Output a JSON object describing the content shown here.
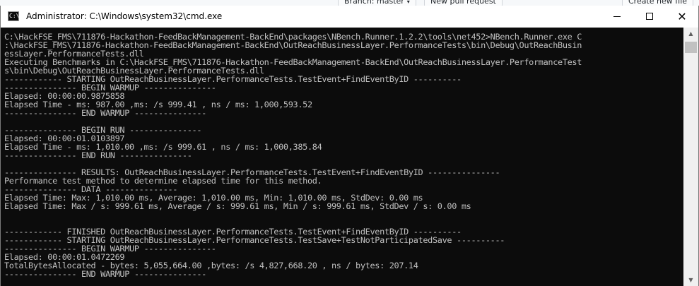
{
  "background": {
    "branch_label": "Branch: master",
    "new_pull_request_label": "New pull request",
    "create_new_file_label": "Create new file"
  },
  "window": {
    "title": "Administrator: C:\\Windows\\system32\\cmd.exe",
    "icon": "cmd-app-icon",
    "icon_glyph": "C:\\",
    "controls": {
      "minimize": "minimize-icon",
      "maximize": "maximize-icon",
      "close": "close-icon",
      "close_glyph": "✕"
    }
  },
  "console": {
    "background_color": "#0c0c0c",
    "text_color": "#c0c0c0",
    "lines": [
      "C:\\HackFSE_FMS\\711876-Hackathon-FeedBackManagement-BackEnd\\packages\\NBench.Runner.1.2.2\\tools\\net452>NBench.Runner.exe C",
      ":\\HackFSE_FMS\\711876-Hackathon-FeedBackManagement-BackEnd\\OutReachBusinessLayer.PerformanceTests\\bin\\Debug\\OutReachBusin",
      "essLayer.PerformanceTests.dll",
      "Executing Benchmarks in C:\\HackFSE_FMS\\711876-Hackathon-FeedBackManagement-BackEnd\\OutReachBusinessLayer.PerformanceTest",
      "s\\bin\\Debug\\OutReachBusinessLayer.PerformanceTests.dll",
      "------------ STARTING OutReachBusinessLayer.PerformanceTests.TestEvent+FindEventByID ----------",
      "--------------- BEGIN WARMUP ---------------",
      "Elapsed: 00:00:00.9875858",
      "Elapsed Time - ms: 987.00 ,ms: /s 999.41 , ns / ms: 1,000,593.52",
      "--------------- END WARMUP ---------------",
      "",
      "--------------- BEGIN RUN ---------------",
      "Elapsed: 00:00:01.0103897",
      "Elapsed Time - ms: 1,010.00 ,ms: /s 999.61 , ns / ms: 1,000,385.84",
      "--------------- END RUN ---------------",
      "",
      "--------------- RESULTS: OutReachBusinessLayer.PerformanceTests.TestEvent+FindEventByID ---------------",
      "Performance test method to determine elapsed time for this method.",
      "--------------- DATA ---------------",
      "Elapsed Time: Max: 1,010.00 ms, Average: 1,010.00 ms, Min: 1,010.00 ms, StdDev: 0.00 ms",
      "Elapsed Time: Max / s: 999.61 ms, Average / s: 999.61 ms, Min / s: 999.61 ms, StdDev / s: 0.00 ms",
      "",
      "",
      "------------ FINISHED OutReachBusinessLayer.PerformanceTests.TestEvent+FindEventByID ----------",
      "------------ STARTING OutReachBusinessLayer.PerformanceTests.TestSave+TestNotParticipatedSave ----------",
      "--------------- BEGIN WARMUP ---------------",
      "Elapsed: 00:00:01.0472269",
      "TotalBytesAllocated - bytes: 5,055,664.00 ,bytes: /s 4,827,668.20 , ns / bytes: 207.14",
      "--------------- END WARMUP ---------------"
    ]
  },
  "scrollbar": {
    "up_glyph": "▲",
    "down_glyph": "▼"
  }
}
